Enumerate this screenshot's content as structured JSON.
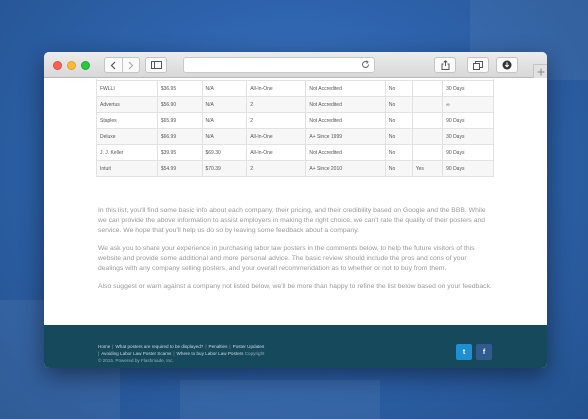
{
  "table": {
    "rows": [
      [
        "FWLLI",
        "$36.95",
        "N/A",
        "All-In-One",
        "Not Accredited",
        "No",
        "",
        "30 Days"
      ],
      [
        "Advertus",
        "$56.90",
        "N/A",
        "2",
        "Not Accredited",
        "No",
        "",
        "∞"
      ],
      [
        "Staples",
        "$65.99",
        "N/A",
        "2",
        "Not Accredited",
        "No",
        "",
        "90 Days"
      ],
      [
        "Deluxe",
        "$66.99",
        "N/A",
        "All-In-One",
        "A+ Since 1999",
        "No",
        "",
        "30 Days"
      ],
      [
        "J. J. Keller",
        "$39.95",
        "$69.30",
        "All-In-One",
        "Not Accredited",
        "No",
        "",
        "90 Days"
      ],
      [
        "Intuit",
        "$54.99",
        "$70.39",
        "2",
        "A+ Since 2010",
        "No",
        "Yes",
        "90 Days"
      ]
    ]
  },
  "paragraphs": [
    "In this list, you'll find some basic info about each company, their pricing, and their credibility based on Google and the BBB. While we can provide the above information to assist employers in making the right choice, we can't rate the quality of their posters and service. We hope that you'll help us do so by leaving some feedback about a company.",
    "We ask you to share your experience in purchasing labor law posters in the comments below, to help the future visitors of this website and provide some additional and more personal advice. The basic review should include the pros and cons of your dealings with any company selling posters, and your overall recommendation as to whether or not to buy from them.",
    "Also suggest or warn against a company not listed below, we'll be more than happy to refine the list below based on your feedback."
  ],
  "footer": {
    "links": [
      "Home",
      "What posters are required to be displayed?",
      "Penalties",
      "Poster Updates",
      "Avoiding Labor Law Poster Scams",
      "Where to buy Labor Law Posters"
    ],
    "copyright_word": "Copyright",
    "powered": "© 2015. Powered by Flashmade, Inc.",
    "twitter_glyph": "t",
    "facebook_glyph": "f"
  },
  "icons": {
    "back": "chevron-left-icon",
    "forward": "chevron-right-icon",
    "sidebar": "sidebar-icon",
    "reload": "reload-icon",
    "share": "share-icon",
    "tabs": "tabs-icon",
    "download": "download-icon",
    "new_tab": "plus-icon"
  },
  "colors": {
    "footer": "#17495c",
    "twitter": "#1e8fd0",
    "facebook": "#315a8e",
    "desktop": "#2e63ad"
  }
}
